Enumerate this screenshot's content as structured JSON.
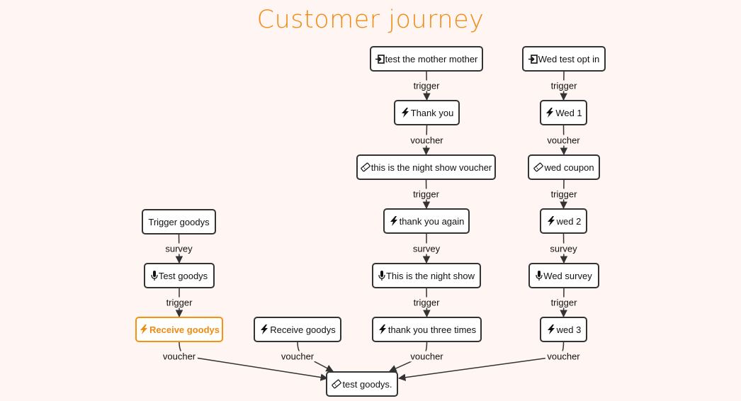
{
  "title": "Customer journey",
  "colors": {
    "accent": "#f18c13",
    "node_border": "#333333",
    "background": "#fff5f3"
  },
  "nodes": [
    {
      "id": "n1",
      "label": "test the mother mother",
      "icon": "entry-icon"
    },
    {
      "id": "n2",
      "label": "Thank you",
      "icon": "lightning-icon"
    },
    {
      "id": "n3",
      "label": "this is the night show voucher",
      "icon": "ticket-icon"
    },
    {
      "id": "n4",
      "label": "thank you again",
      "icon": "lightning-icon"
    },
    {
      "id": "n5",
      "label": "This is the night show",
      "icon": "microphone-icon"
    },
    {
      "id": "n6",
      "label": "thank you three times",
      "icon": "lightning-icon"
    },
    {
      "id": "m1",
      "label": "Wed test opt in",
      "icon": "entry-icon"
    },
    {
      "id": "m2",
      "label": "Wed 1",
      "icon": "lightning-icon"
    },
    {
      "id": "m3",
      "label": "wed coupon",
      "icon": "ticket-icon"
    },
    {
      "id": "m4",
      "label": "wed 2",
      "icon": "lightning-icon"
    },
    {
      "id": "m5",
      "label": "Wed survey",
      "icon": "microphone-icon"
    },
    {
      "id": "m6",
      "label": "wed 3",
      "icon": "lightning-icon"
    },
    {
      "id": "g1",
      "label": "Trigger goodys",
      "icon": ""
    },
    {
      "id": "g2",
      "label": "Test goodys",
      "icon": "microphone-icon"
    },
    {
      "id": "g3",
      "label": "Receive goodys",
      "icon": "lightning-icon",
      "active": true
    },
    {
      "id": "r1",
      "label": "Receive goodys",
      "icon": "lightning-icon"
    },
    {
      "id": "t1",
      "label": "test goodys.",
      "icon": "ticket-icon"
    }
  ],
  "edges": [
    {
      "from": "n1",
      "to": "n2",
      "label": "trigger"
    },
    {
      "from": "n2",
      "to": "n3",
      "label": "voucher"
    },
    {
      "from": "n3",
      "to": "n4",
      "label": "trigger"
    },
    {
      "from": "n4",
      "to": "n5",
      "label": "survey"
    },
    {
      "from": "n5",
      "to": "n6",
      "label": "trigger"
    },
    {
      "from": "n6",
      "to": "t1",
      "label": "voucher"
    },
    {
      "from": "m1",
      "to": "m2",
      "label": "trigger"
    },
    {
      "from": "m2",
      "to": "m3",
      "label": "voucher"
    },
    {
      "from": "m3",
      "to": "m4",
      "label": "trigger"
    },
    {
      "from": "m4",
      "to": "m5",
      "label": "survey"
    },
    {
      "from": "m5",
      "to": "m6",
      "label": "trigger"
    },
    {
      "from": "m6",
      "to": "t1",
      "label": "voucher"
    },
    {
      "from": "g1",
      "to": "g2",
      "label": "survey"
    },
    {
      "from": "g2",
      "to": "g3",
      "label": "trigger"
    },
    {
      "from": "g3",
      "to": "t1",
      "label": "voucher"
    },
    {
      "from": "r1",
      "to": "t1",
      "label": "voucher"
    }
  ]
}
